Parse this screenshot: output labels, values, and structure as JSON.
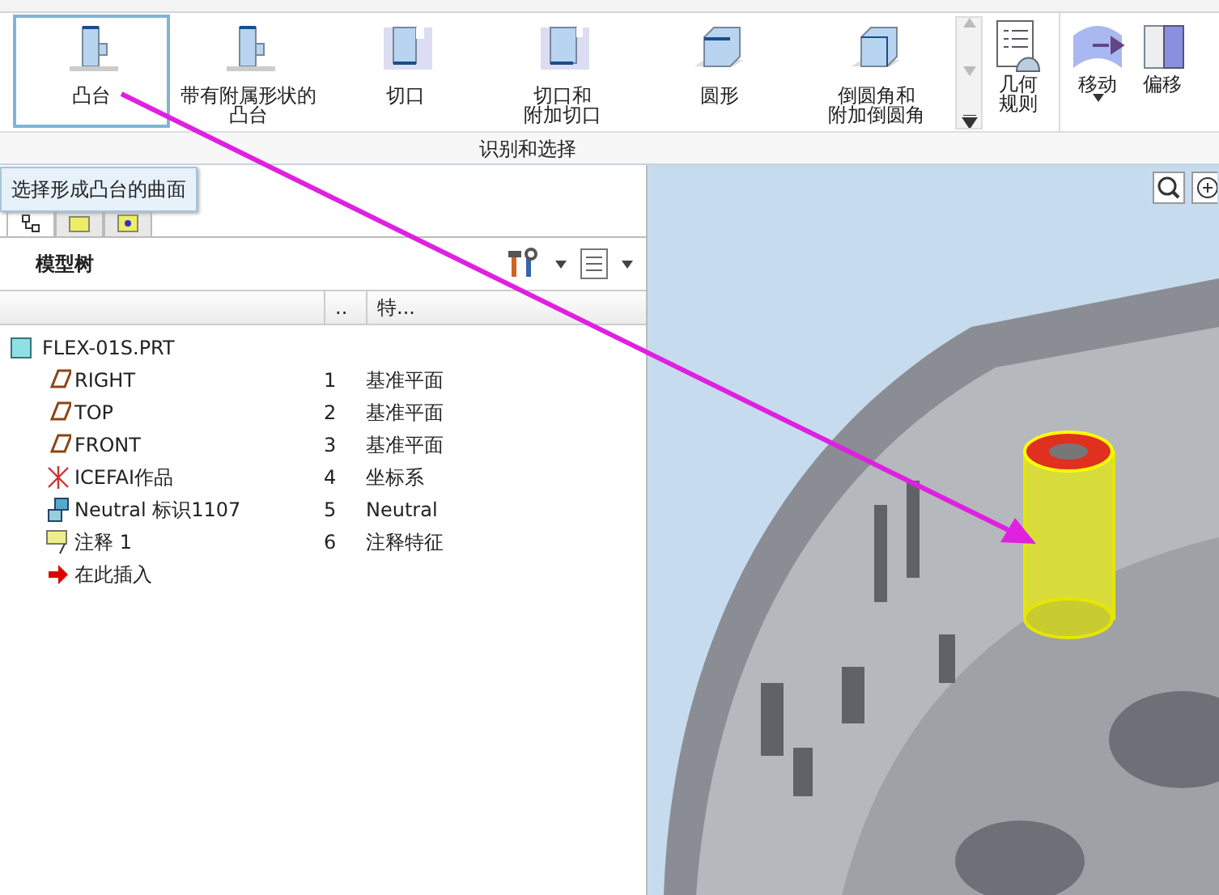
{
  "ribbon": {
    "gallery": [
      {
        "label": "凸台",
        "selected": true
      },
      {
        "label": "带有附属形状的凸台",
        "selected": false
      },
      {
        "label": "切口",
        "selected": false
      },
      {
        "lines": [
          "切口和",
          "附加切口"
        ],
        "selected": false
      },
      {
        "label": "圆形",
        "selected": false
      },
      {
        "lines": [
          "倒圆角和",
          "附加倒圆角"
        ],
        "selected": false
      }
    ],
    "rules_button": {
      "lines": [
        "几何",
        "规则"
      ]
    },
    "group_label": "识别和选择",
    "tools": [
      {
        "label": "移动",
        "has_dropdown": true
      },
      {
        "label": "偏移",
        "has_dropdown": false
      }
    ]
  },
  "tooltip": "选择形成凸台的曲面",
  "panel_tabs": [
    {
      "selected": true
    },
    {
      "selected": false
    },
    {
      "selected": false
    }
  ],
  "model_tree": {
    "title": "模型树",
    "columns": [
      "..",
      "特..."
    ],
    "root": {
      "name": "FLEX-01S.PRT",
      "children": [
        {
          "kind": "plane",
          "name": "RIGHT",
          "number": "1",
          "type": "基准平面"
        },
        {
          "kind": "plane",
          "name": "TOP",
          "number": "2",
          "type": "基准平面"
        },
        {
          "kind": "plane",
          "name": "FRONT",
          "number": "3",
          "type": "基准平面"
        },
        {
          "kind": "csys",
          "name": "ICEFAI作品",
          "number": "4",
          "type": "坐标系"
        },
        {
          "kind": "neutral",
          "name": "Neutral 标识1107",
          "number": "5",
          "type": "Neutral"
        },
        {
          "kind": "note",
          "name": "注释 1",
          "number": "6",
          "type": "注释特征"
        },
        {
          "kind": "insert",
          "name": "在此插入"
        }
      ]
    }
  }
}
